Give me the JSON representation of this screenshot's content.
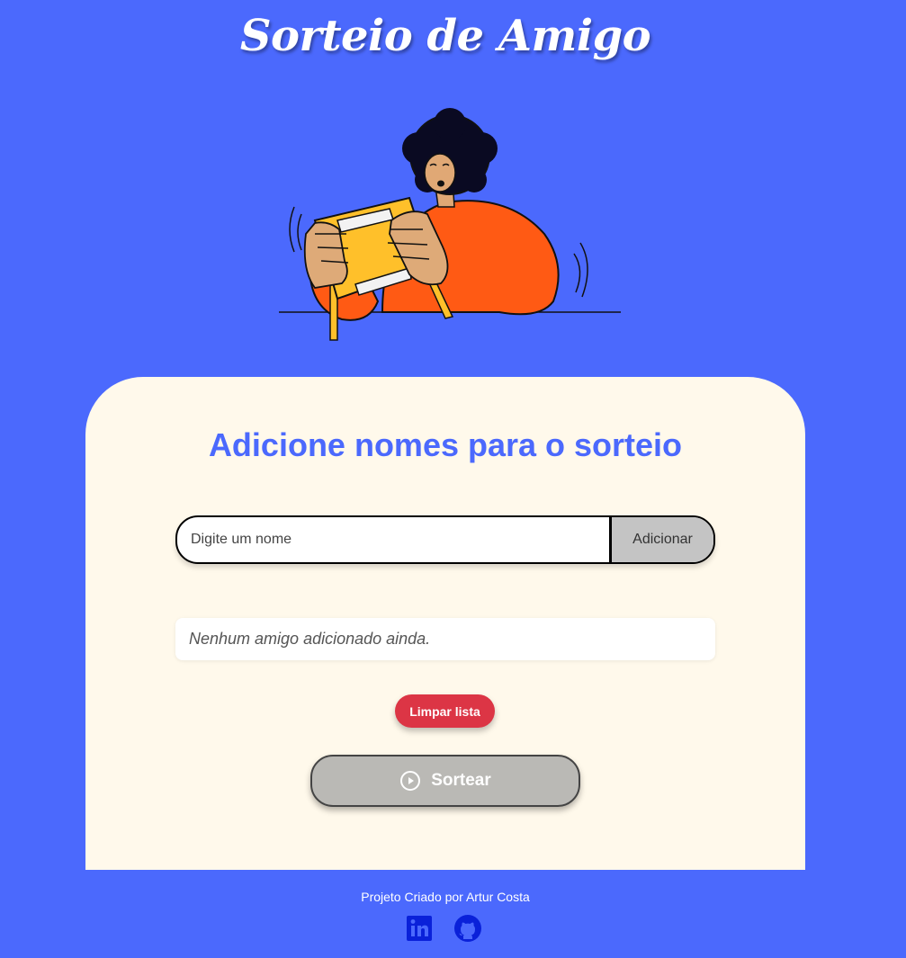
{
  "header": {
    "title": "Sorteio de Amigo"
  },
  "illustration": {
    "icon": "person-holding-gift-illustration"
  },
  "main": {
    "heading": "Adicione nomes para o sorteio",
    "name_input": {
      "placeholder": "Digite um nome",
      "value": ""
    },
    "add_button_label": "Adicionar",
    "friends_list": {
      "items": [],
      "empty_message": "Nenhum amigo adicionado ainda."
    },
    "clear_button_label": "Limpar lista",
    "draw_button": {
      "label": "Sortear",
      "icon": "play-circle-icon"
    }
  },
  "footer": {
    "credit": "Projeto Criado por Artur Costa",
    "links": [
      {
        "icon": "linkedin-icon"
      },
      {
        "icon": "github-icon"
      }
    ]
  },
  "colors": {
    "background": "#4B69FD",
    "card": "#FFF9EB",
    "accent": "#4B69FD",
    "danger": "#DC3545",
    "disabled_button": "#BAB9B5",
    "social_icons": "#0A21D9"
  }
}
